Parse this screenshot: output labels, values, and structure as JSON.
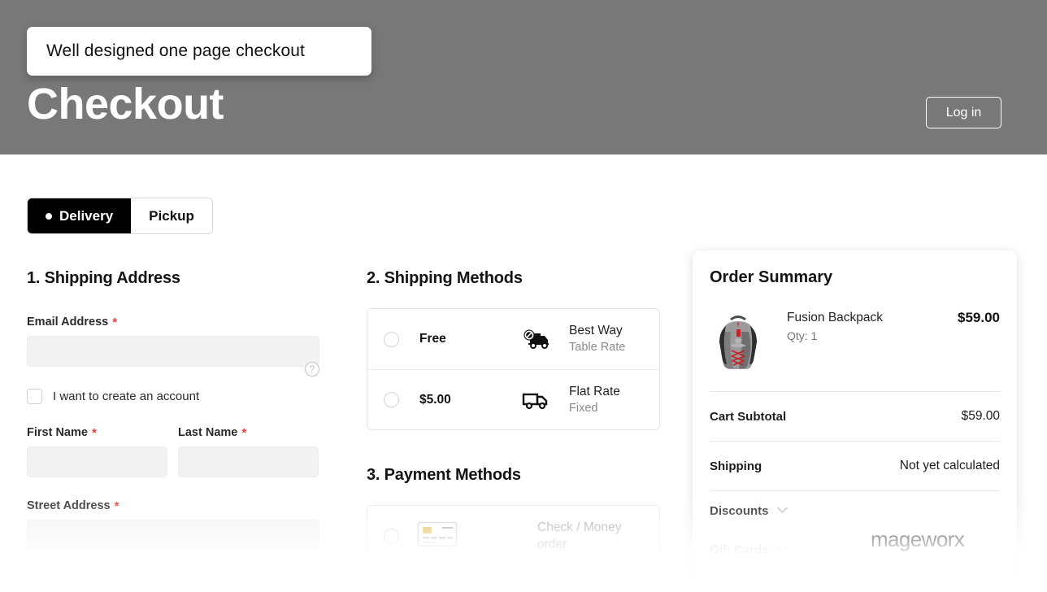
{
  "header": {
    "callout_text": "Well designed one page checkout",
    "title": "Checkout",
    "login_label": "Log in",
    "bg_color": "#787878"
  },
  "mode_tabs": [
    {
      "label": "Delivery",
      "active": true
    },
    {
      "label": "Pickup",
      "active": false
    }
  ],
  "shipping_address": {
    "section_title": "1. Shipping Address",
    "email_label": "Email Address",
    "email_value": "",
    "email_placeholder": "",
    "required_mark": "*",
    "help_icon_glyph": "?",
    "create_account_label": "I want to create an account",
    "create_account_checked": false,
    "first_name_label": "First Name",
    "first_name_value": "",
    "last_name_label": "Last Name",
    "last_name_value": "",
    "street_label": "Street Address",
    "street_value": ""
  },
  "shipping_methods": {
    "section_title": "2. Shipping Methods",
    "options": [
      {
        "price": "Free",
        "name": "Best Way",
        "sub": "Table Rate",
        "icon": "truck-free-icon",
        "selected": false
      },
      {
        "price": "$5.00",
        "name": "Flat Rate",
        "sub": "Fixed",
        "icon": "truck-icon",
        "selected": false
      }
    ]
  },
  "payment_methods": {
    "section_title": "3. Payment Methods",
    "options": [
      {
        "name": "Check / Money order",
        "icon": "credit-card-icon",
        "selected": false
      }
    ]
  },
  "order_summary": {
    "title": "Order Summary",
    "product": {
      "name": "Fusion Backpack",
      "qty_label": "Qty: 1",
      "price": "$59.00",
      "image": "backpack-image"
    },
    "totals": [
      {
        "label": "Cart Subtotal",
        "value": "$59.00"
      },
      {
        "label": "Shipping",
        "value": "Not yet calculated"
      }
    ],
    "collapsibles": [
      {
        "label": "Discounts",
        "chevron": "⌄",
        "muted": false
      },
      {
        "label": "Gift Cards",
        "chevron": "⌄",
        "muted": true
      }
    ]
  },
  "watermark": "mageworx"
}
